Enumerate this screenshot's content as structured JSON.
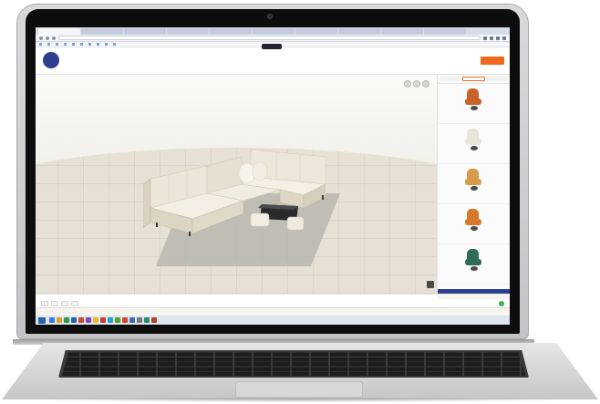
{
  "browser": {
    "tabs": [
      "",
      "",
      "",
      "",
      "",
      "",
      "",
      "",
      "",
      ""
    ],
    "url": "",
    "bookmarks": [
      "",
      "",
      "",
      "",
      "",
      "",
      "",
      "",
      "",
      ""
    ]
  },
  "site": {
    "logo_text": "",
    "subtitle": "",
    "nav_links": [
      "",
      ""
    ],
    "cta_label": "",
    "center_label": ""
  },
  "viewport": {
    "tools": [
      "",
      "",
      ""
    ],
    "hint": ""
  },
  "panel": {
    "tabs": [
      "",
      "",
      ""
    ],
    "products": [
      {
        "name": "",
        "subname": "",
        "color": "#c8642a"
      },
      {
        "name": "",
        "subname": "",
        "color": "#e7e4da"
      },
      {
        "name": "",
        "subname": "",
        "color": "#d89b4b"
      },
      {
        "name": "",
        "subname": "",
        "color": "#d8782c"
      },
      {
        "name": "",
        "subname": "",
        "color": "#2f6b57"
      }
    ]
  },
  "toolbar": {
    "buttons": [
      "",
      "",
      "",
      ""
    ],
    "status": ""
  },
  "taskbar": {
    "icon_colors": [
      "#3c7bd4",
      "#e2a12a",
      "#2a9d4b",
      "#2a62a8",
      "#d04a2f",
      "#8e44ad",
      "#e8b923",
      "#cf3b2e",
      "#27a3c9",
      "#5aa02c",
      "#d6452b",
      "#3a6fb0",
      "#7a7a7a",
      "#2c8c6e",
      "#b0452a"
    ],
    "clock": ""
  },
  "colors": {
    "accent": "#ef6a1f",
    "brand": "#2d3f8e",
    "status_ok": "#37b34a"
  }
}
